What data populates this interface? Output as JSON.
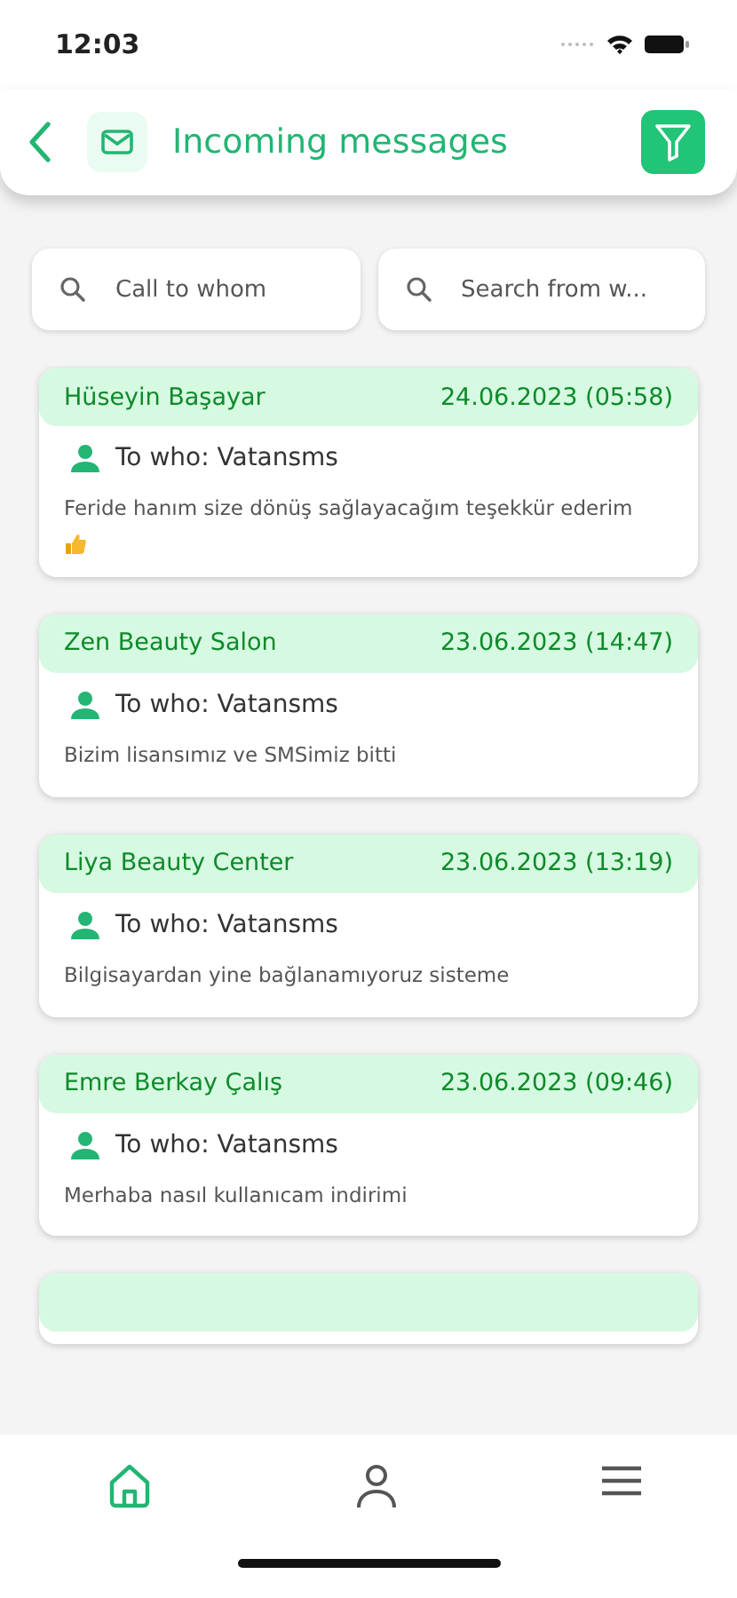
{
  "status_bar": {
    "time": "12:03"
  },
  "header": {
    "title": "Incoming messages"
  },
  "search": [
    {
      "placeholder": "Call to whom"
    },
    {
      "placeholder": "Search from w..."
    }
  ],
  "messages": [
    {
      "sender": "Hüseyin Başayar",
      "date": "24.06.2023 (05:58)",
      "recipient": "To who: Vatansms",
      "text": "Feride hanım size dönüş sağlayacağım teşekkür ederim",
      "thumbs_up": true
    },
    {
      "sender": "Zen Beauty Salon",
      "date": "23.06.2023 (14:47)",
      "recipient": "To who: Vatansms",
      "text": "Bizim lisansımız ve SMSimiz bitti",
      "thumbs_up": false
    },
    {
      "sender": "Liya Beauty Center",
      "date": "23.06.2023 (13:19)",
      "recipient": "To who: Vatansms",
      "text": "Bilgisayardan yine bağlanamıyoruz sisteme",
      "thumbs_up": false
    },
    {
      "sender": "Emre Berkay Çalış",
      "date": "23.06.2023 (09:46)",
      "recipient": "To who: Vatansms",
      "text": "Merhaba nasıl kullanıcam indirimi",
      "thumbs_up": false
    }
  ],
  "nav": [
    {
      "kind": "home",
      "selected": true
    },
    {
      "kind": "profile",
      "selected": false
    },
    {
      "kind": "menu",
      "selected": false
    }
  ]
}
